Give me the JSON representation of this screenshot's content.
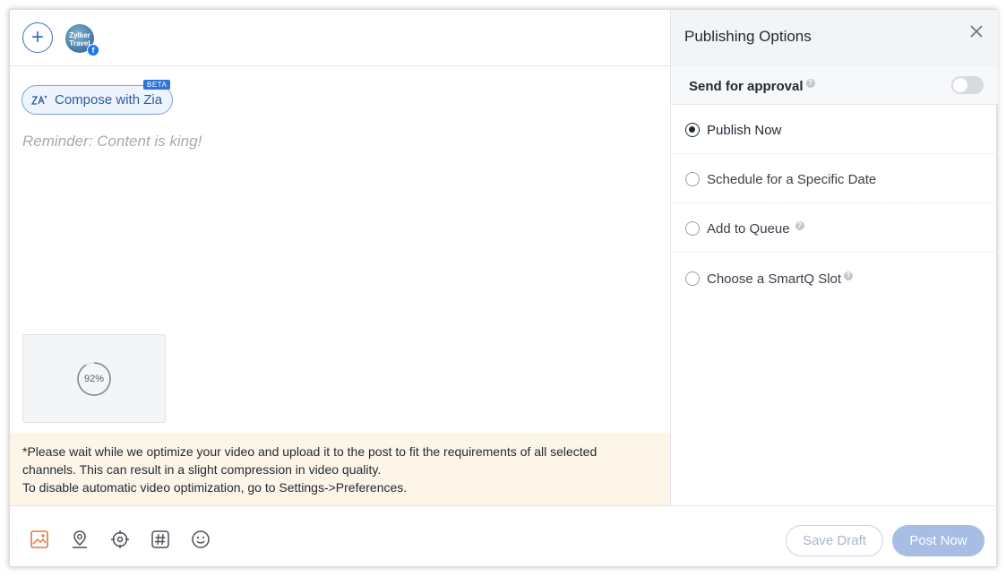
{
  "composer": {
    "avatar_text": "Zylker Travel",
    "zia_button_label": "Compose with Zia",
    "beta_badge": "BETA",
    "placeholder": "Reminder: Content is king!",
    "video_progress": "92%",
    "video_progress_fraction": 0.92,
    "notice_line1": "*Please wait while we optimize your video and upload it to the post to fit the requirements of all selected",
    "notice_line2": "channels. This can result in a slight compression in video quality.",
    "notice_line3": "To disable automatic video optimization, go to Settings->Preferences."
  },
  "toolbar": {
    "tools": [
      "image-icon",
      "location-icon",
      "target-icon",
      "hashtag-icon",
      "emoji-icon"
    ],
    "save_draft_label": "Save Draft",
    "post_now_label": "Post Now"
  },
  "publishing": {
    "title": "Publishing Options",
    "approval_label": "Send for approval",
    "approval_enabled": false,
    "options": [
      {
        "label": "Publish Now",
        "selected": true,
        "help": false
      },
      {
        "label": "Schedule for a Specific Date",
        "selected": false,
        "help": false
      },
      {
        "label": "Add to Queue",
        "selected": false,
        "help": true
      },
      {
        "label": "Choose a SmartQ Slot",
        "selected": false,
        "help": true
      }
    ]
  },
  "colors": {
    "accent": "#3b6fc1",
    "notice_bg": "#fdf5e7",
    "post_button": "#a7bde3",
    "image_tool": "#e8763a"
  }
}
